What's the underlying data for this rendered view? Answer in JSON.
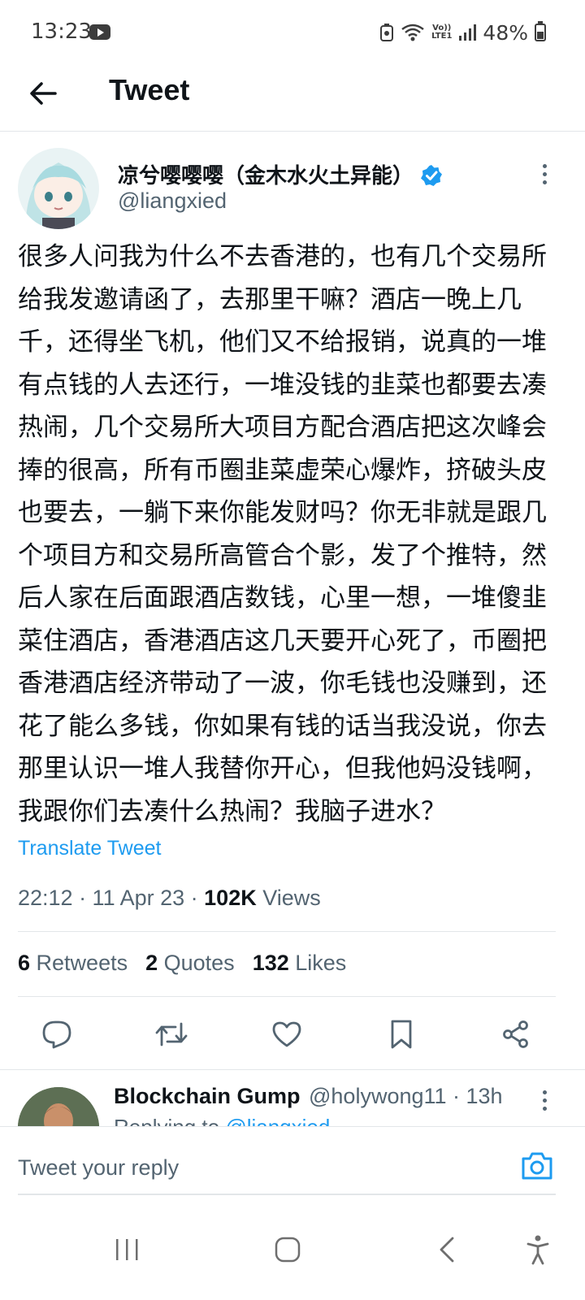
{
  "status_bar": {
    "time": "13:23",
    "battery_percent": "48%",
    "battery_level": 0.48,
    "lte_top": "Vo))",
    "lte_bottom": "LTE1",
    "icons": [
      "youtube-icon",
      "battery-saver-icon",
      "wifi-icon",
      "lte-icon",
      "signal-icon",
      "battery-icon"
    ]
  },
  "header": {
    "title": "Tweet"
  },
  "tweet": {
    "author_name": "凉兮嘤嘤嘤（金木水火土异能）",
    "author_handle": "@liangxied",
    "verified": true,
    "text": "很多人问我为什么不去香港的，也有几个交易所给我发邀请函了，去那里干嘛？酒店一晚上几千，还得坐飞机，他们又不给报销，说真的一堆有点钱的人去还行，一堆没钱的韭菜也都要去凑热闹，几个交易所大项目方配合酒店把这次峰会捧的很高，所有币圈韭菜虚荣心爆炸，挤破头皮也要去，一躺下来你能发财吗？你无非就是跟几个项目方和交易所高管合个影，发了个推特，然后人家在后面跟酒店数钱，心里一想，一堆傻韭菜住酒店，香港酒店这几天要开心死了，币圈把香港酒店经济带动了一波，你毛钱也没赚到，还花了能么多钱，你如果有钱的话当我没说，你去那里认识一堆人我替你开心，但我他妈没钱啊，我跟你们去凑什么热闹？我脑子进水？",
    "translate_label": "Translate Tweet",
    "timestamp": "22:12 · 11 Apr 23 · ",
    "views_count": "102K",
    "views_label": " Views",
    "retweets_count": "6",
    "retweets_label": " Retweets",
    "quotes_count": "2",
    "quotes_label": " Quotes",
    "likes_count": "132",
    "likes_label": " Likes"
  },
  "actions": [
    "reply-icon",
    "retweet-icon",
    "like-icon",
    "bookmark-icon",
    "share-icon"
  ],
  "reply_preview": {
    "name": "Blockchain Gump",
    "meta": "@holywong11 · 13h",
    "replying_prefix": "Replying to ",
    "replying_handle": "@liangxied"
  },
  "composer": {
    "placeholder": "Tweet your reply"
  },
  "colors": {
    "accent": "#1d9bf0",
    "text": "#0f1419",
    "secondary": "#536471",
    "divider": "#e3e6e9"
  }
}
